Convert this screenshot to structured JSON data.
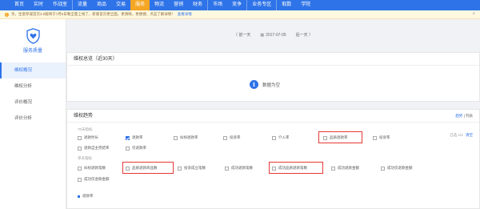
{
  "nav": {
    "items": [
      "首页",
      "实时",
      "作战室",
      "流量",
      "商品",
      "交易",
      "服务",
      "物流",
      "营销",
      "财务",
      "市场",
      "竞争",
      "业务专区",
      "取数",
      "学院"
    ],
    "active_index": 6,
    "accent_color": "#2e73e8",
    "active_color": "#f5a623"
  },
  "notice": {
    "text": "亲，生意参谋首页3.0版将于7月5日晚全量上线了，新版首页更全面，更清晰，更便捷，点击了解详情！",
    "link": "查看详情"
  },
  "sidebar": {
    "title": "服务质量",
    "items": [
      "维权概况",
      "维权分析",
      "评价概况",
      "评价分析"
    ],
    "active_index": 0
  },
  "date_bar": {
    "prev": "〈 前一天",
    "date": "2017-07-05",
    "next": "后一天 〉"
  },
  "overview": {
    "title": "维权总览（近30天）",
    "empty_text": "数据为空"
  },
  "trend": {
    "title": "维权趋势",
    "view_chart": "趋势",
    "view_list": "列表",
    "section1_label": "70天指标",
    "section2_label": "单天指标",
    "selected_count": "已选 1/4",
    "clear_label": "清空",
    "section1": [
      {
        "label": "退款时长",
        "checked": false
      },
      {
        "label": "退款率",
        "checked": true
      },
      {
        "label": "纠纷退款率",
        "checked": false
      },
      {
        "label": "投诉率",
        "checked": false
      },
      {
        "label": "介入率",
        "checked": false
      },
      {
        "label": "品质退款率",
        "checked": false
      },
      {
        "label": "投诉率",
        "checked": false
      },
      {
        "label": "退款自主完结率",
        "checked": false
      },
      {
        "label": "仅退款率",
        "checked": false
      }
    ],
    "section2": [
      {
        "label": "纠纷退款笔数",
        "checked": false
      },
      {
        "label": "品质退款商品数",
        "checked": false
      },
      {
        "label": "投诉成立笔数",
        "checked": false
      },
      {
        "label": "成功退款笔数",
        "checked": false
      },
      {
        "label": "成功品质退款笔数",
        "checked": false
      },
      {
        "label": "成功退款金额",
        "checked": false
      },
      {
        "label": "成功仅退款金额",
        "checked": false
      },
      {
        "label": "成功仅退款金额",
        "checked": false
      }
    ],
    "legend": "退款率"
  }
}
